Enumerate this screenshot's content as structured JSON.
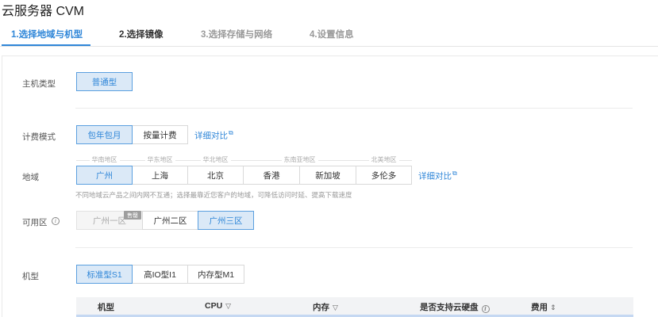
{
  "page": {
    "title": "云服务器 CVM"
  },
  "steps": [
    {
      "label": "1.选择地域与机型"
    },
    {
      "label": "2.选择镜像"
    },
    {
      "label": "3.选择存储与网络"
    },
    {
      "label": "4.设置信息"
    }
  ],
  "host_type": {
    "label": "主机类型",
    "options": [
      "普通型"
    ]
  },
  "billing": {
    "label": "计费模式",
    "options": [
      "包年包月",
      "按量计费"
    ],
    "compare_link": "详细对比"
  },
  "region": {
    "label": "地域",
    "groups": [
      "华南地区",
      "华东地区",
      "华北地区",
      "东南亚地区",
      "北美地区"
    ],
    "options": [
      "广州",
      "上海",
      "北京",
      "香港",
      "新加坡",
      "多伦多"
    ],
    "compare_link": "详细对比",
    "hint": "不同地域云产品之间内网不互通；选择最靠近您客户的地域，可降低访问时延、提高下载速度"
  },
  "zone": {
    "label": "可用区",
    "options": [
      "广州一区",
      "广州二区",
      "广州三区"
    ],
    "sold_out_badge": "售罄"
  },
  "instance": {
    "label": "机型",
    "options": [
      "标准型S1",
      "高IO型I1",
      "内存型M1"
    ],
    "table_headers": [
      "机型",
      "CPU",
      "内存",
      "是否支持云硬盘",
      "费用"
    ]
  },
  "icons": {
    "external": "external-link-icon",
    "info": "info-icon",
    "filter": "filter-icon",
    "sort": "sort-icon"
  },
  "colors": {
    "accent": "#2f86d8",
    "selected_bg": "#dbe9f7",
    "sold_out": "#9e9e9e"
  }
}
